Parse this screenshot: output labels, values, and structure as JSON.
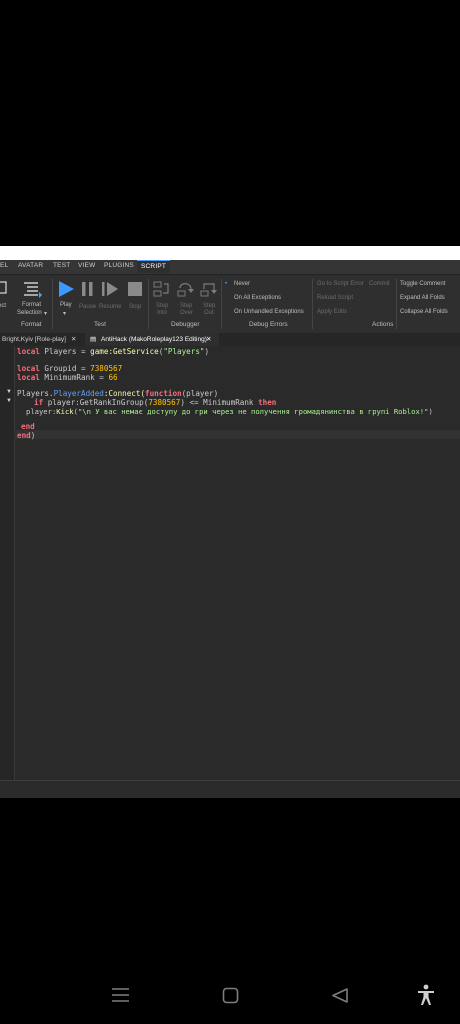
{
  "menu": [
    "EL",
    "AVATAR",
    "TEST",
    "VIEW",
    "PLUGINS",
    "SCRIPT"
  ],
  "ribbon": {
    "format": {
      "btn1": "ect",
      "btn2_line1": "Format",
      "btn2_line2": "Selection",
      "group": "Format"
    },
    "test": {
      "play": "Play",
      "pause": "Pause",
      "resume": "Resume",
      "stop": "Stop",
      "group": "Test"
    },
    "debugger": {
      "step_into_1": "Step",
      "step_into_2": "Into",
      "step_over_1": "Step",
      "step_over_2": "Over",
      "step_out_1": "Step",
      "step_out_2": "Out",
      "group": "Debugger"
    },
    "debug_errors": {
      "never": "Never",
      "all": "On All Exceptions",
      "unhandled": "On Unhandled Exceptions",
      "group": "Debug Errors"
    },
    "actions": {
      "goto": "Go to Script Error",
      "commit": "Commit",
      "reload": "Reload Script",
      "replace": "Apply Edits",
      "toggle_comment": "Toggle Comment",
      "expand": "Expand All Folds",
      "collapse": "Collapse All Folds",
      "group": "Actions"
    }
  },
  "tabs": [
    {
      "label": "Bright,Kyiv [Role-play]"
    },
    {
      "label": "AntiHack (MakoRoleplay123 Editing)"
    }
  ],
  "code": {
    "l1_kw": "local",
    "l1_a": " Players = ",
    "l1_fn": "game:GetService",
    "l1_b": "(",
    "l1_str": "\"Players\"",
    "l1_c": ")",
    "l3_kw": "local",
    "l3_a": " Groupid = ",
    "l3_num": "7380567",
    "l4_kw": "local",
    "l4_a": " MinimumRank = ",
    "l4_num": "66",
    "l6_a": "Players.",
    "l6_prop": "PlayerAdded",
    "l6_fn": ":Connect(",
    "l6_kw": "function",
    "l6_b": "(player)",
    "l7_kw": "if",
    "l7_a": " player:GetRankInGroup(",
    "l7_num": "7380567",
    "l7_b": ") <= MinimumRank ",
    "l7_kw2": "then",
    "l8_a": "player:",
    "l8_fn": "Kick",
    "l8_b": "(",
    "l8_str": "\"\\n У вас немає доступу до гри через не получення громадянинства в групі Roblox!\"",
    "l8_c": ")",
    "l10_kw": "end",
    "l11_kw": "end",
    "l11_a": ")"
  },
  "colors": {
    "accent": "#4ea1ff",
    "keyword": "#f86d7c",
    "string": "#adf195",
    "number": "#ffc600"
  },
  "navbar": {
    "icons": [
      "menu-icon",
      "home-square-icon",
      "back-triangle-icon",
      "accessibility-icon"
    ]
  }
}
